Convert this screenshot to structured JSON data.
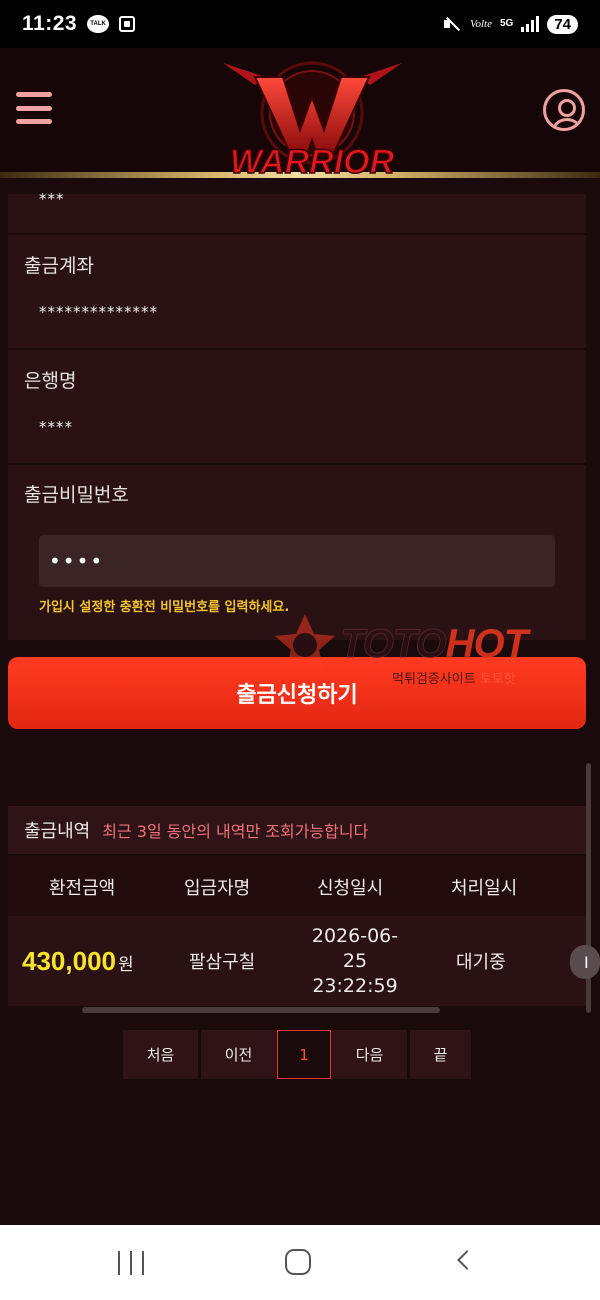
{
  "status_bar": {
    "time": "11:23",
    "talk_badge": "TALK",
    "volte": "Volte",
    "network": "5G",
    "battery": "74",
    "icons": [
      "kakaotalk-icon",
      "screen-capture-icon",
      "mute-icon",
      "volte-icon",
      "signal-icon",
      "battery-icon"
    ]
  },
  "header": {
    "logo_text": "WARRIOR",
    "logo_letter": "W",
    "colors": {
      "accent": "#f0a1a1",
      "logo_red": "#d4161c",
      "gold": "#d6b46a"
    }
  },
  "form": {
    "partial_value": "***",
    "fields": [
      {
        "label": "출금계좌",
        "value": "**************"
      },
      {
        "label": "은행명",
        "value": "****"
      },
      {
        "label": "출금비밀번호",
        "value": "••••"
      }
    ],
    "hint": "가입시 설정한 충환전 비밀번호를 입력하세요.",
    "submit_label": "출금신청하기"
  },
  "watermark": {
    "brand_a": "TOTO",
    "brand_b": "HOT",
    "sub_a": "먹튀검증사이트",
    "sub_b": "토토핫"
  },
  "history": {
    "title": "출금내역",
    "note": "최근 3일 동안의 내역만 조회가능합니다",
    "columns": [
      "환전금액",
      "입금자명",
      "신청일시",
      "처리일시"
    ],
    "rows": [
      {
        "amount": "430,000",
        "unit": "원",
        "depositor": "팔삼구칠",
        "date_line1": "2026-06-",
        "date_line2": "25",
        "date_line3": "23:22:59",
        "status": "대기중",
        "more": "I"
      }
    ]
  },
  "pagination": {
    "first": "처음",
    "prev": "이전",
    "current": "1",
    "next": "다음",
    "last": "끝"
  }
}
